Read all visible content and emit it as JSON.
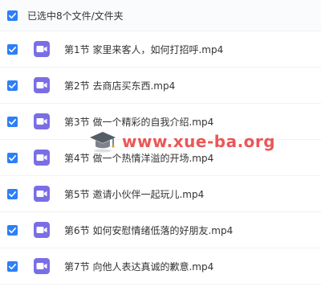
{
  "header": {
    "selection_text": "已选中8个文件/文件夹"
  },
  "files": [
    {
      "name": "第1节 家里来客人，如何打招呼.mp4"
    },
    {
      "name": "第2节 去商店买东西.mp4"
    },
    {
      "name": "第3节 做一个精彩的自我介绍.mp4"
    },
    {
      "name": "第4节 做一个热情洋溢的开场.mp4"
    },
    {
      "name": "第5节 邀请小伙伴一起玩儿.mp4"
    },
    {
      "name": "第6节 如何安慰情绪低落的好朋友.mp4"
    },
    {
      "name": "第7节 向他人表达真诚的歉意.mp4"
    }
  ],
  "watermark": {
    "text": "www.xue-ba.org"
  },
  "icons": {
    "checkbox": "checkmark-icon",
    "file_type": "video-file-icon",
    "watermark": "graduation-cap-icon"
  },
  "colors": {
    "checkbox": "#2d7ff9",
    "video_icon": "#7a6ee6",
    "watermark": "#e83a3a"
  }
}
